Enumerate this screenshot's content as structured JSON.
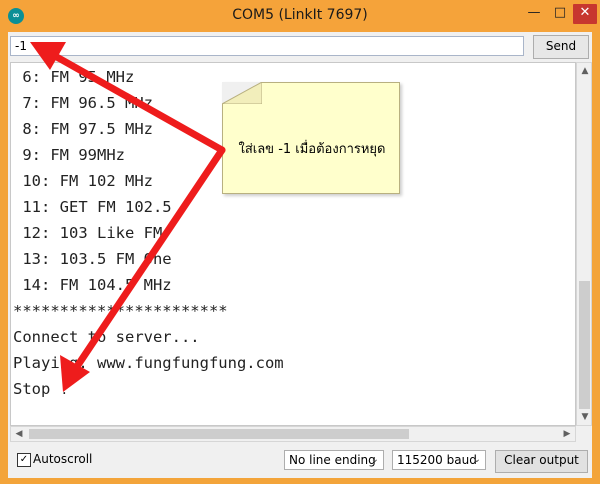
{
  "window": {
    "title": "COM5 (LinkIt 7697)",
    "app_icon_glyph": "∞",
    "minimize_glyph": "—",
    "maximize_glyph": "□",
    "close_glyph": "✕"
  },
  "input_row": {
    "value": "-1",
    "send_label": "Send"
  },
  "serial_output": {
    "lines": [
      " 6: FM 95 MHz",
      " 7: FM 96.5 MHz",
      " 8: FM 97.5 MHz",
      " 9: FM 99MHz",
      " 10: FM 102 MHz",
      " 11: GET FM 102.5",
      " 12: 103 Like FM",
      " 13: 103.5 FM One",
      " 14: FM 104.5 MHz",
      "***********************",
      "Connect to server...",
      "Playing: www.fungfungfung.com",
      "Stop !"
    ]
  },
  "bottom_bar": {
    "autoscroll_label": "Autoscroll",
    "autoscroll_checked": true,
    "line_ending": "No line ending",
    "baud": "115200 baud",
    "clear_label": "Clear output"
  },
  "annotation": {
    "note_text": "ใส่เลข -1 เมื่อต้องการหยุด",
    "arrow_color": "#ee1c1c",
    "note_color": "#ffffcc"
  },
  "icons": {
    "app": "arduino-icon",
    "scroll_up": "chevron-up-icon",
    "scroll_down": "chevron-down-icon",
    "scroll_left": "chevron-left-icon",
    "scroll_right": "chevron-right-icon"
  }
}
